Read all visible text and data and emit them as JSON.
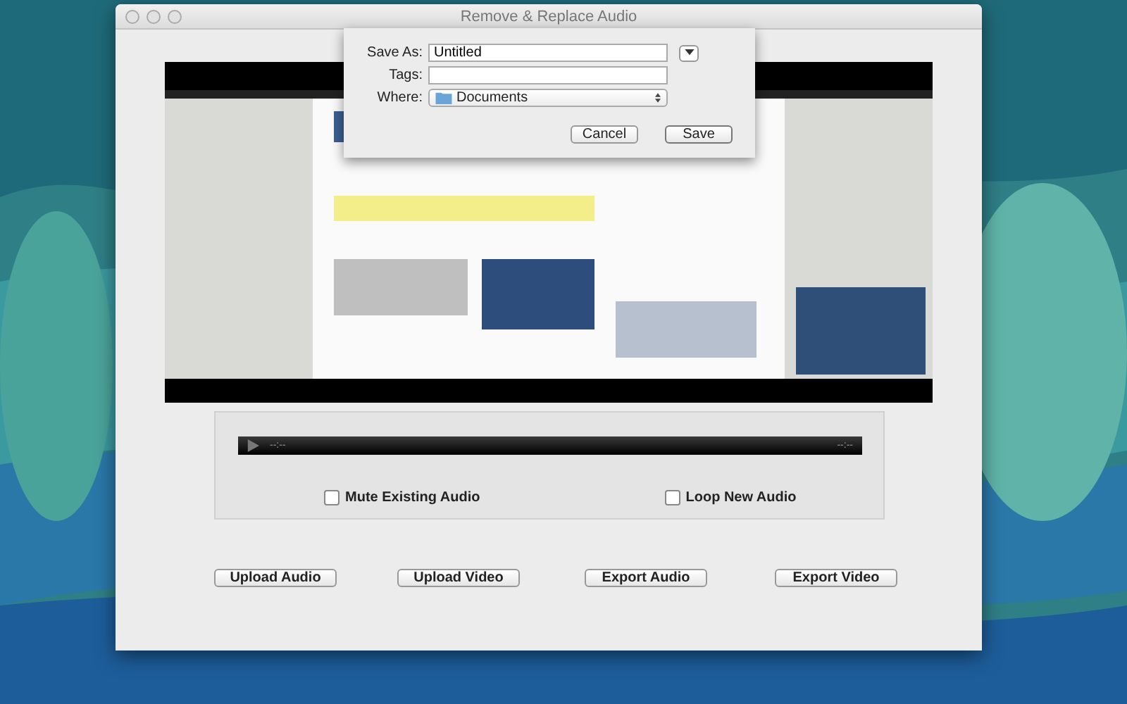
{
  "window": {
    "title": "Remove & Replace Audio"
  },
  "save_sheet": {
    "fields": [
      {
        "label": "Save As:",
        "value": "Untitled"
      },
      {
        "label": "Tags:"
      }
    ],
    "where": {
      "label": "Where:",
      "value": "Documents"
    },
    "buttons": [
      {
        "label": "Cancel",
        "kind": "cancel"
      },
      {
        "label": "Save",
        "kind": "default"
      }
    ]
  },
  "player": {
    "elapsed": "--:--",
    "remaining": "--:--"
  },
  "options": [
    {
      "label": "Mute Existing Audio",
      "checked": false
    },
    {
      "label": "Loop New Audio",
      "checked": false
    }
  ],
  "buttons": [
    "Upload Audio",
    "Upload Video",
    "Export Audio",
    "Export Video"
  ]
}
